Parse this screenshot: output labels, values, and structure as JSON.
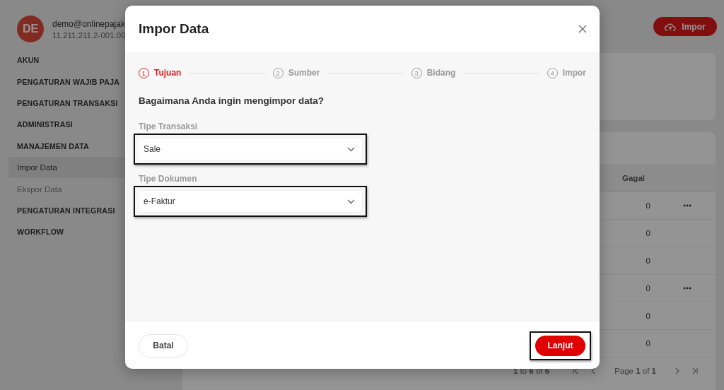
{
  "page": {
    "user": {
      "initials": "DE",
      "email": "demo@onlinepajak",
      "npwp": "11.211.211.2-001.00"
    },
    "sidebar": {
      "items": [
        {
          "label": "AKUN",
          "kind": "section"
        },
        {
          "label": "PENGATURAN WAJIB PAJA",
          "kind": "section"
        },
        {
          "label": "PENGATURAN TRANSAKSI",
          "kind": "section"
        },
        {
          "label": "ADMINISTRASI",
          "kind": "section"
        },
        {
          "label": "MANAJEMEN DATA",
          "kind": "section"
        },
        {
          "label": "Impor Data",
          "kind": "sub",
          "selected": true
        },
        {
          "label": "Ekspor Data",
          "kind": "sub",
          "selected": false
        },
        {
          "label": "PENGATURAN INTEGRASI",
          "kind": "section"
        },
        {
          "label": "WORKFLOW",
          "kind": "section"
        }
      ]
    },
    "import_button": "Impor",
    "table": {
      "columns": [
        "Gagal"
      ],
      "rows": [
        {
          "gagal": "0",
          "has_menu": true
        },
        {
          "gagal": "0",
          "has_menu": false
        },
        {
          "gagal": "0",
          "has_menu": false
        },
        {
          "gagal": "0",
          "has_menu": true
        },
        {
          "gagal": "0",
          "has_menu": false
        },
        {
          "gagal": "0",
          "has_menu": false
        }
      ]
    },
    "pagination": {
      "range": "**1** to **6** of **6**",
      "page": "Page **1** of **1**"
    }
  },
  "dialog": {
    "title": "Impor Data",
    "steps": [
      {
        "number": "1",
        "label": "Tujuan",
        "selected": true
      },
      {
        "number": "2",
        "label": "Sumber",
        "selected": false
      },
      {
        "number": "3",
        "label": "Bidang",
        "selected": false
      },
      {
        "number": "4",
        "label": "Impor",
        "selected": false
      }
    ],
    "question": "Bagaimana Anda ingin mengimpor data?",
    "fields": [
      {
        "label": "Tipe Transaksi",
        "value": "Sale",
        "highlighted": true
      },
      {
        "label": "Tipe Dokumen",
        "value": "e-Faktur",
        "highlighted": true
      }
    ],
    "buttons": [
      {
        "label": "Batal",
        "kind": "secondary",
        "highlighted": false
      },
      {
        "label": "Lanjut",
        "kind": "primary",
        "highlighted": true
      }
    ]
  }
}
